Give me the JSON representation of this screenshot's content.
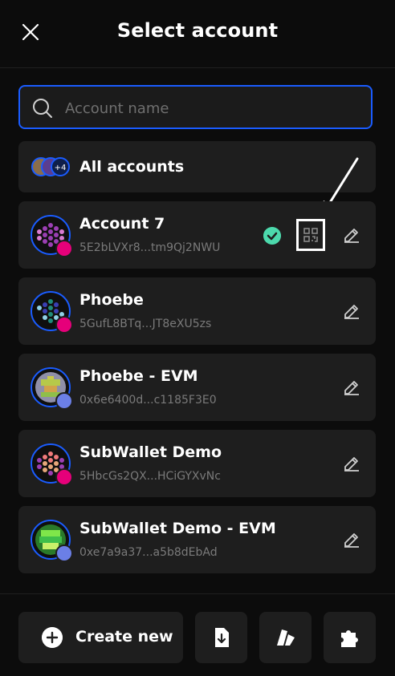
{
  "header": {
    "title": "Select account"
  },
  "search": {
    "placeholder": "Account name"
  },
  "all_accounts": {
    "label": "All accounts",
    "badge": "+4"
  },
  "accounts": [
    {
      "name": "Account 7",
      "address": "5E2bLVXr8...tm9Qj2NWU",
      "chain": "polkadot",
      "selected": true
    },
    {
      "name": "Phoebe",
      "address": "5GufL8BTq...JT8eXU5zs",
      "chain": "polkadot"
    },
    {
      "name": "Phoebe - EVM",
      "address": "0x6e6400d...c1185F3E0",
      "chain": "ethereum"
    },
    {
      "name": "SubWallet Demo",
      "address": "5HbcGs2QX...HCiGYXvNc",
      "chain": "polkadot"
    },
    {
      "name": "SubWallet Demo - EVM",
      "address": "0xe7a9a37...a5b8dEbAd",
      "chain": "ethereum"
    }
  ],
  "footer": {
    "create_label": "Create new",
    "icons": [
      "import-icon",
      "sticker-icon",
      "puzzle-icon"
    ]
  },
  "colors": {
    "accent": "#1a5cff",
    "selected": "#4cd9ac",
    "polkadot": "#e6007a",
    "ethereum": "#6b7fe6"
  }
}
